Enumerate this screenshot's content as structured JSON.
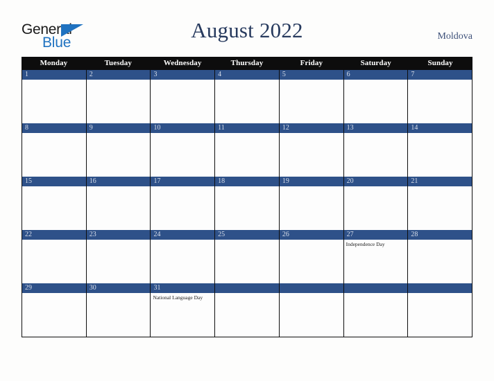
{
  "brand": {
    "name_part1": "General",
    "name_part2": "Blue",
    "triangle_icon": "triangle-icon",
    "accent_color": "#1f72c0"
  },
  "header": {
    "title": "August 2022",
    "country": "Moldova",
    "title_color": "#273a5e",
    "country_color": "#3c4f78"
  },
  "calendar": {
    "month": "August",
    "year": "2022",
    "header_bg": "#0d0d0d",
    "day_bar_color": "#2e5189",
    "day_number_color": "#d9dfea",
    "grid_border_color": "#0d0d0d",
    "cell_bg": "#fdfdfd",
    "weekdays": [
      "Monday",
      "Tuesday",
      "Wednesday",
      "Thursday",
      "Friday",
      "Saturday",
      "Sunday"
    ],
    "weeks": [
      [
        {
          "day": "1",
          "events": []
        },
        {
          "day": "2",
          "events": []
        },
        {
          "day": "3",
          "events": []
        },
        {
          "day": "4",
          "events": []
        },
        {
          "day": "5",
          "events": []
        },
        {
          "day": "6",
          "events": []
        },
        {
          "day": "7",
          "events": []
        }
      ],
      [
        {
          "day": "8",
          "events": []
        },
        {
          "day": "9",
          "events": []
        },
        {
          "day": "10",
          "events": []
        },
        {
          "day": "11",
          "events": []
        },
        {
          "day": "12",
          "events": []
        },
        {
          "day": "13",
          "events": []
        },
        {
          "day": "14",
          "events": []
        }
      ],
      [
        {
          "day": "15",
          "events": []
        },
        {
          "day": "16",
          "events": []
        },
        {
          "day": "17",
          "events": []
        },
        {
          "day": "18",
          "events": []
        },
        {
          "day": "19",
          "events": []
        },
        {
          "day": "20",
          "events": []
        },
        {
          "day": "21",
          "events": []
        }
      ],
      [
        {
          "day": "22",
          "events": []
        },
        {
          "day": "23",
          "events": []
        },
        {
          "day": "24",
          "events": []
        },
        {
          "day": "25",
          "events": []
        },
        {
          "day": "26",
          "events": []
        },
        {
          "day": "27",
          "events": [
            "Independence Day"
          ]
        },
        {
          "day": "28",
          "events": []
        }
      ],
      [
        {
          "day": "29",
          "events": []
        },
        {
          "day": "30",
          "events": []
        },
        {
          "day": "31",
          "events": [
            "National Language Day"
          ]
        },
        {
          "day": "",
          "events": []
        },
        {
          "day": "",
          "events": []
        },
        {
          "day": "",
          "events": []
        },
        {
          "day": "",
          "events": []
        }
      ]
    ]
  }
}
